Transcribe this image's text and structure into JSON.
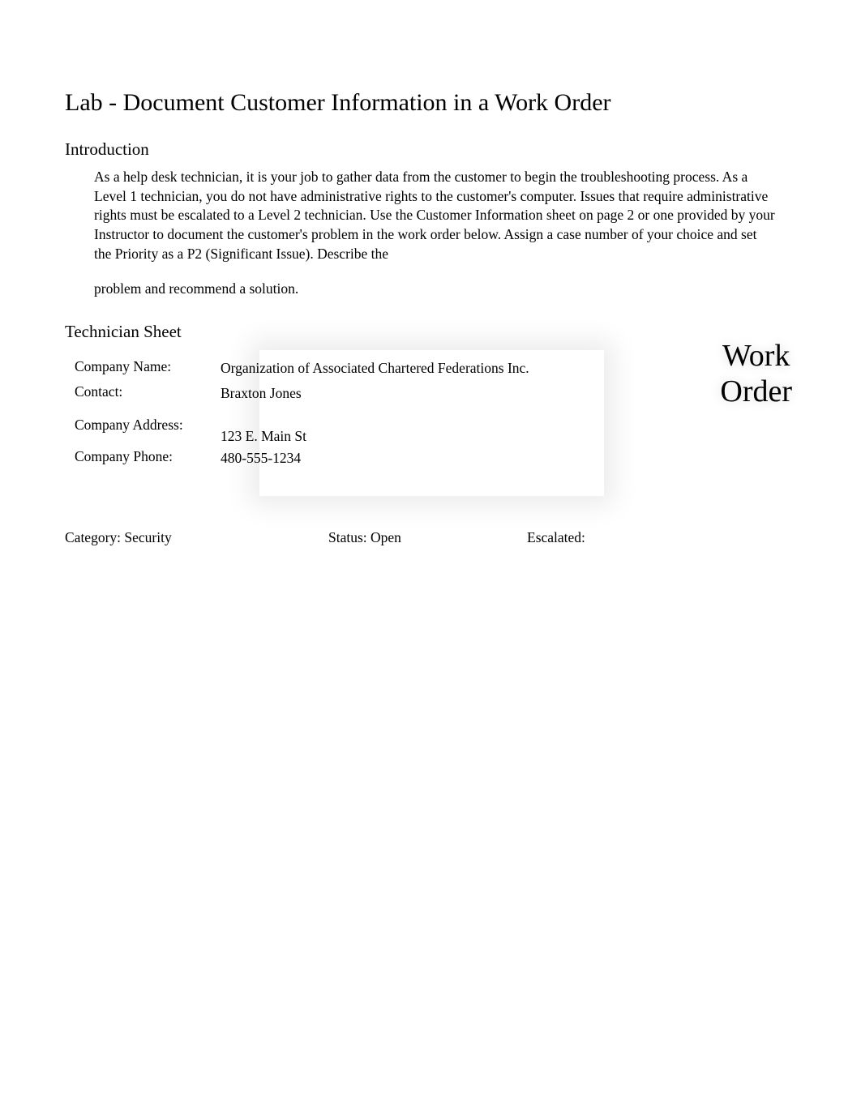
{
  "title": "Lab - Document Customer Information in a Work Order",
  "introduction": {
    "heading": "Introduction",
    "paragraph1": "As a help desk technician, it is your job to gather data from the customer to begin the troubleshooting process. As a Level 1 technician, you do not have administrative rights to the customer's computer. Issues that require administrative rights must be escalated to a Level 2 technician. Use the Customer Information sheet on page 2 or one provided by your Instructor to document the customer's problem in the work order below. Assign a case number of your choice and set the Priority as a P2 (Significant Issue). Describe the",
    "paragraph2": "problem and recommend a solution."
  },
  "technician_sheet": {
    "heading": "Technician Sheet",
    "rows": [
      {
        "label": "Company Name:",
        "value": "Organization of Associated Chartered Federations Inc."
      },
      {
        "label": "Contact:",
        "value": "Braxton Jones"
      },
      {
        "label": "Company Address:",
        "value": "123 E. Main St"
      },
      {
        "label": "Company Phone:",
        "value": "480-555-1234"
      }
    ]
  },
  "work_order_label": {
    "line1": "Work",
    "line2": "Order"
  },
  "status_row": {
    "category_label": "Category: ",
    "category_value": "Security",
    "status_label": "Status: ",
    "status_value": "Open",
    "escalated_label": "Escalated:",
    "escalated_value": ""
  }
}
